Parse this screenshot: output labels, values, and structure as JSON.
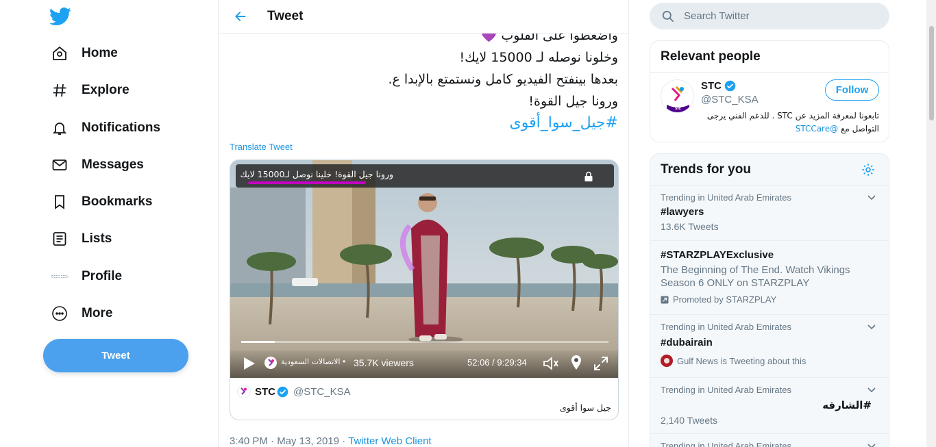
{
  "nav": {
    "items": [
      {
        "label": "Home",
        "icon": "home-icon"
      },
      {
        "label": "Explore",
        "icon": "hashtag-icon"
      },
      {
        "label": "Notifications",
        "icon": "bell-icon"
      },
      {
        "label": "Messages",
        "icon": "envelope-icon"
      },
      {
        "label": "Bookmarks",
        "icon": "bookmark-icon"
      },
      {
        "label": "Lists",
        "icon": "list-icon"
      },
      {
        "label": "Profile",
        "icon": "profile-avatar-icon"
      },
      {
        "label": "More",
        "icon": "more-circle-icon"
      }
    ],
    "tweet_button": "Tweet"
  },
  "header": {
    "title": "Tweet"
  },
  "tweet": {
    "lines": [
      "واضغطوا على القلوب 💜",
      "وخلونا نوصله لـ 15000 لايك!",
      "بعدها بينفتح الفيديو كامل ونستمتع بالإبدا ع.",
      "ورونا جيل القوة!"
    ],
    "hashtag": "#جيل_سوا_أقوى",
    "translate_label": "Translate Tweet",
    "meta_time": "3:40 PM · May 13, 2019 · ",
    "meta_client": "Twitter Web Client"
  },
  "video": {
    "overlay_title": "ورونا جيل القوة! خلينا نوصل لـ15000 لايك",
    "channel_name": "الاتصالات السعودية",
    "viewers": "35.7K viewers",
    "time_readout": "52:06 / 9:29:34",
    "progress_fraction": 0.091,
    "card_name": "STC",
    "card_handle": "@STC_KSA",
    "card_caption": "جيل سوا أقوى"
  },
  "search": {
    "placeholder": "Search Twitter"
  },
  "relevant": {
    "title": "Relevant people",
    "person": {
      "name": "STC",
      "handle": "@STC_KSA",
      "follow_label": "Follow",
      "bio_text": "تابعونا لمعرفة المزيد عن STC . للدعم الفني يرجى التواصل مع ",
      "bio_mention": "@STCCare"
    }
  },
  "trends": {
    "title": "Trends for you",
    "items": [
      {
        "context": "Trending in United Arab Emirates",
        "name": "#lawyers",
        "count": "13.6K Tweets"
      },
      {
        "name": "#STARZPLAYExclusive",
        "description": "The Beginning of The End. Watch Vikings Season 6 ONLY on STARZPLAY",
        "promoted": "Promoted by STARZPLAY"
      },
      {
        "context": "Trending in United Arab Emirates",
        "name": "#dubairain",
        "source": "Gulf News is Tweeting about this"
      },
      {
        "context": "Trending in United Arab Emirates",
        "name": "#الشارقه",
        "count": "2,140 Tweets"
      },
      {
        "context": "Trending in United Arab Emirates"
      }
    ]
  },
  "colors": {
    "accent": "#1da1f2",
    "tweet_button": "#4ca1ee",
    "muted": "#657786",
    "progress_highlight": "#c200c2"
  }
}
